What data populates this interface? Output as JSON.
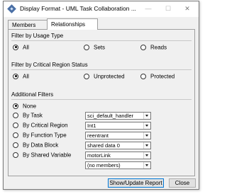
{
  "window": {
    "title": "Display Format - UML Task Collaboration ...",
    "minimize_glyph": "—",
    "maximize_glyph": "☐",
    "close_glyph": "✕"
  },
  "tabs": [
    {
      "label": "Members",
      "active": false
    },
    {
      "label": "Relationships",
      "active": true
    }
  ],
  "usage_filter": {
    "label": "Filter by Usage Type",
    "options": [
      {
        "label": "All",
        "checked": true
      },
      {
        "label": "Sets",
        "checked": false
      },
      {
        "label": "Reads",
        "checked": false
      }
    ]
  },
  "critical_filter": {
    "label": "Filter by Critical Region Status",
    "options": [
      {
        "label": "All",
        "checked": true
      },
      {
        "label": "Unprotected",
        "checked": false
      },
      {
        "label": "Protected",
        "checked": false
      }
    ]
  },
  "additional_filters": {
    "label": "Additional Filters",
    "none_label": "None",
    "rows": [
      {
        "label": "By Task",
        "value": "sci_default_handler"
      },
      {
        "label": "By Critical Region",
        "value": "Int1"
      },
      {
        "label": "By Function Type",
        "value": "reentrant"
      },
      {
        "label": "By Data Block",
        "value": "shared data 0"
      },
      {
        "label": "By Shared Variable",
        "value": "motorLink"
      }
    ],
    "members_value": "(no members)"
  },
  "buttons": {
    "update_label": "Show/Update Report",
    "close_label": "Close"
  }
}
